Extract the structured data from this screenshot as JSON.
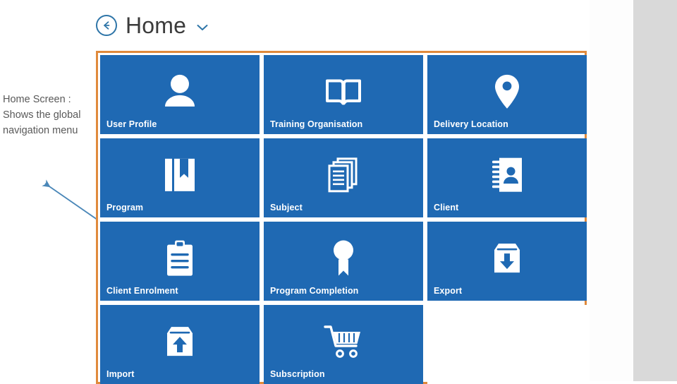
{
  "header": {
    "back_icon": "back-arrow-circle-icon",
    "title": "Home",
    "dropdown_icon": "chevron-down-icon"
  },
  "annotation": {
    "text": "Home Screen : Shows the global navigation menu",
    "arrow_icon": "pointer-arrow-icon",
    "arrow_color": "#4a87b8"
  },
  "colors": {
    "tile_blue": "#1f69b3",
    "panel_border_orange": "#e08a3c",
    "annotation_text": "#595959",
    "accent_blue": "#2e75a8",
    "gutter_gray": "#d9d9d9"
  },
  "tiles": [
    {
      "label": "User Profile",
      "icon": "user-profile-icon",
      "empty": false
    },
    {
      "label": "Training Organisation",
      "icon": "open-book-icon",
      "empty": false
    },
    {
      "label": "Delivery Location",
      "icon": "map-pin-icon",
      "empty": false
    },
    {
      "label": "Program",
      "icon": "bookmarked-book-icon",
      "empty": false
    },
    {
      "label": "Subject",
      "icon": "stacked-documents-icon",
      "empty": false
    },
    {
      "label": "Client",
      "icon": "address-book-icon",
      "empty": false
    },
    {
      "label": "Client Enrolment",
      "icon": "clipboard-icon",
      "empty": false
    },
    {
      "label": "Program Completion",
      "icon": "award-ribbon-icon",
      "empty": false
    },
    {
      "label": "Export",
      "icon": "box-download-icon",
      "empty": false
    },
    {
      "label": "Import",
      "icon": "box-upload-icon",
      "empty": false
    },
    {
      "label": "Subscription",
      "icon": "shopping-cart-icon",
      "empty": false
    },
    {
      "label": "",
      "icon": "",
      "empty": true
    }
  ]
}
